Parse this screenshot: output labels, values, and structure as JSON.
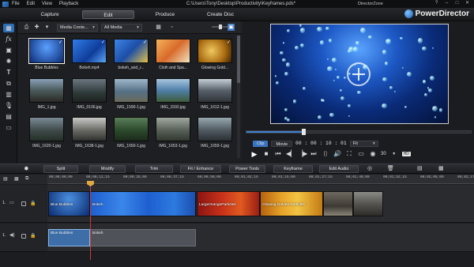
{
  "menu": [
    "File",
    "Edit",
    "View",
    "Playback"
  ],
  "window_path": "C:\\Users\\Tony\\Desktop\\Productivity\\Keyframes.pds*",
  "window_buttons": [
    "?",
    "–",
    "□",
    "✕"
  ],
  "modes": [
    {
      "label": "Capture",
      "active": false
    },
    {
      "label": "Edit",
      "active": true
    },
    {
      "label": "Produce",
      "active": false
    },
    {
      "label": "Create Disc",
      "active": false
    }
  ],
  "brand": "PowerDirector",
  "directorzone": "DirectorZone",
  "library": {
    "content_filter": "Media Conte...",
    "media_filter": "All Media",
    "items": [
      {
        "label": "Blue Bubbles",
        "checked": true,
        "selected": true
      },
      {
        "label": "Bokeh.mp4",
        "checked": true
      },
      {
        "label": "bokeh_and_r...",
        "checked": true
      },
      {
        "label": "Cloth and Spa..."
      },
      {
        "label": "Glowing Gold...",
        "checked": true
      },
      {
        "label": "IMG_1.jpg"
      },
      {
        "label": "IMG_0106.jpg"
      },
      {
        "label": "IMG_1590-1.jpg"
      },
      {
        "label": "IMG_1592.jpg"
      },
      {
        "label": "IMG_1612-1.jpg"
      },
      {
        "label": "IMG_1620-1.jpg"
      },
      {
        "label": "IMG_1638-1.jpg"
      },
      {
        "label": "IMG_1650-1.jpg"
      },
      {
        "label": "IMG_1653-1.jpg"
      },
      {
        "label": "IMG_1659-1.jpg"
      }
    ]
  },
  "preview": {
    "clip_label": "Clip",
    "movie_label": "Movie",
    "timecode": "00 : 00 : 10 : 01",
    "fit_label": "Fit",
    "fps_value": "30",
    "hd_badge": "HD"
  },
  "edit_toolbar": [
    "Split",
    "Modify",
    "Trim",
    "Fit / Enhance",
    "Power Tools",
    "Keyframe",
    "Edit Audio"
  ],
  "ruler_ticks": [
    "00;00;00;00",
    "00;00;12;15",
    "00;00;25;00",
    "00;00;37;15",
    "00;00;50;00",
    "00;01;02;15",
    "00;01;15;00",
    "00;01;27;15",
    "00;01;40;00",
    "00;01;52;15",
    "00;02;05;00",
    "00;02;17;15"
  ],
  "tracks": [
    {
      "number": "1."
    },
    {
      "number": "1."
    }
  ],
  "video_clips": [
    {
      "label": "Blue Bubbles"
    },
    {
      "label": "Bokeh"
    },
    {
      "label": "LargeOrangeParticles"
    },
    {
      "label": "Glowing Golden Particles"
    },
    {
      "label": ""
    },
    {
      "label": ""
    }
  ],
  "audio_clips": [
    {
      "label": "Blue Bubbles"
    },
    {
      "label": "Bokeh"
    }
  ]
}
